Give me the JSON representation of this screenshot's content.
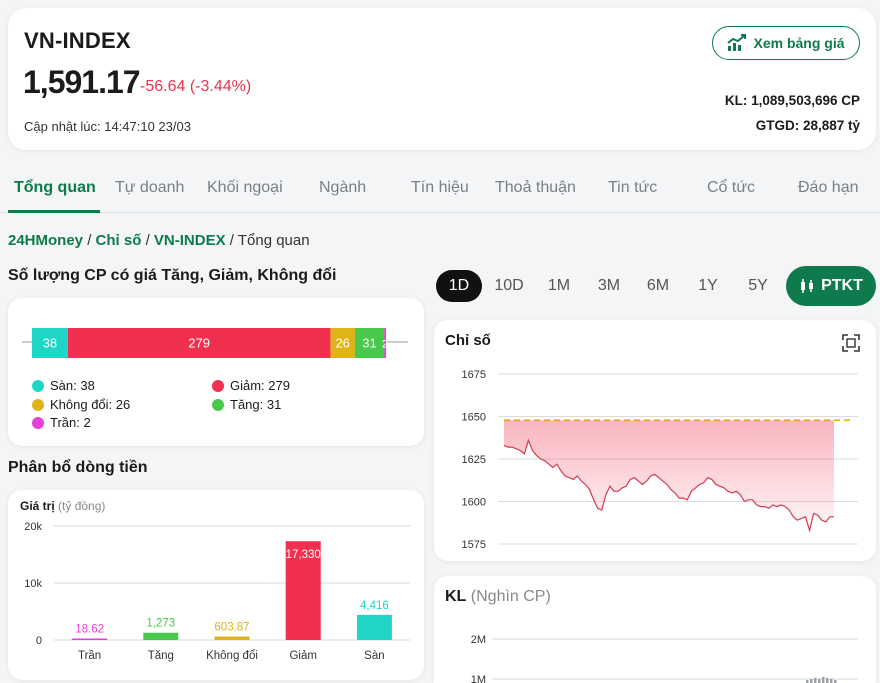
{
  "header": {
    "index_name": "VN-INDEX",
    "price": "1,591.17",
    "change": "-56.64 (-3.44%)",
    "updated": "Cập nhật lúc: 14:47:10 23/03",
    "board_button": "Xem bảng giá",
    "volume": "KL: 1,089,503,696 CP",
    "value": "GTGD: 28,887 tỷ"
  },
  "tabs": [
    "Tổng quan",
    "Tự doanh",
    "Khối ngoại",
    "Ngành",
    "Tín hiệu",
    "Thoả thuận",
    "Tin tức",
    "Cổ tức",
    "Đáo hạn"
  ],
  "breadcrumb": {
    "home": "24HMoney",
    "sep": "/",
    "section": "Chỉ số",
    "index": "VN-INDEX",
    "current": "Tổng quan"
  },
  "stock_count": {
    "title": "Số lượng CP có giá Tăng, Giảm, Không đổi",
    "segments": [
      {
        "key": "san",
        "value": 38,
        "label": "38",
        "color": "#1fd6c6"
      },
      {
        "key": "giam",
        "value": 279,
        "label": "279",
        "color": "#f0304e"
      },
      {
        "key": "khongdoi",
        "value": 26,
        "label": "26",
        "color": "#e0b418"
      },
      {
        "key": "tang",
        "value": 31,
        "label": "31",
        "color": "#49c94c"
      },
      {
        "key": "tran",
        "value": 2,
        "label": "2",
        "color": "#e83fd8"
      }
    ],
    "legend": [
      {
        "label": "Sàn: 38",
        "color": "#1fd6c6"
      },
      {
        "label": "Giảm: 279",
        "color": "#f0304e"
      },
      {
        "label": "Không đổi: 26",
        "color": "#e0b418"
      },
      {
        "label": "Tăng: 31",
        "color": "#49c94c"
      },
      {
        "label": "Trần: 2",
        "color": "#e83fd8"
      }
    ]
  },
  "money_flow": {
    "title": "Phân bổ dòng tiền",
    "ylabel": "Giá trị",
    "yunit": "(tỷ đồng)",
    "yticks": [
      "20k",
      "10k",
      "0"
    ]
  },
  "chart_data": [
    {
      "type": "bar",
      "categories": [
        "Trần",
        "Tăng",
        "Không đổi",
        "Giảm",
        "Sàn"
      ],
      "values": [
        18.62,
        1273,
        603.87,
        17330,
        4416
      ],
      "data_labels": [
        "18.62",
        "1,273",
        "603.87",
        "17,330",
        "4,416"
      ],
      "colors": [
        "#e83fd8",
        "#49c94c",
        "#e0b418",
        "#f0304e",
        "#1fd6c6"
      ],
      "ylim": [
        0,
        20000
      ]
    },
    {
      "type": "area",
      "title": "Chỉ số",
      "yticks": [
        1675,
        1650,
        1625,
        1600,
        1575
      ],
      "ylim": [
        1570,
        1680
      ],
      "reference": 1647.81,
      "y": [
        1633,
        1632,
        1632,
        1631,
        1630,
        1628,
        1636,
        1630,
        1627,
        1625,
        1624,
        1622,
        1620,
        1622,
        1618,
        1615,
        1614,
        1613,
        1615,
        1612,
        1610,
        1607,
        1601,
        1596,
        1595,
        1604,
        1609,
        1606,
        1606,
        1608,
        1609,
        1613,
        1614,
        1612,
        1610,
        1612,
        1615,
        1616,
        1614,
        1612,
        1610,
        1607,
        1605,
        1602,
        1602,
        1601,
        1606,
        1608,
        1610,
        1611,
        1614,
        1613,
        1610,
        1609,
        1608,
        1606,
        1605,
        1606,
        1604,
        1600,
        1601,
        1601,
        1598,
        1597,
        1597,
        1596,
        1598,
        1597,
        1598,
        1597,
        1595,
        1591,
        1589,
        1590,
        1591,
        1583,
        1593,
        1592,
        1589,
        1588,
        1591,
        1591
      ]
    },
    {
      "type": "bar",
      "title": "KL",
      "unit": "(Nghìn CP)",
      "yticks": [
        "2M",
        "1M"
      ]
    }
  ],
  "periods": [
    "1D",
    "10D",
    "1M",
    "3M",
    "6M",
    "1Y",
    "5Y"
  ],
  "ptkt_label": "PTKT",
  "colors": {
    "accent": "#0f7a4c",
    "down": "#e8344d"
  }
}
